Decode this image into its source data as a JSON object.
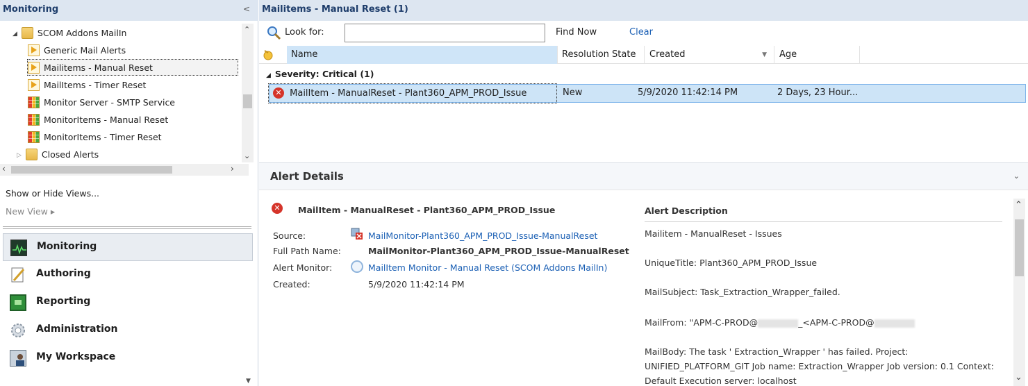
{
  "left": {
    "header_title": "Monitoring",
    "collapse_glyph": "<",
    "tree": [
      {
        "label": "SCOM Addons MailIn",
        "icon": "folder-icon",
        "expand": "▲"
      },
      {
        "label": "Generic Mail Alerts",
        "icon": "alert-view-icon"
      },
      {
        "label": "Mailitems - Manual Reset",
        "icon": "alert-view-icon",
        "selected": true
      },
      {
        "label": "MailItems - Timer Reset",
        "icon": "alert-view-icon"
      },
      {
        "label": "Monitor Server - SMTP Service",
        "icon": "state-view-icon"
      },
      {
        "label": "MonitorItems - Manual Reset",
        "icon": "state-view-icon"
      },
      {
        "label": "MonitorItems - Timer Reset",
        "icon": "state-view-icon"
      },
      {
        "label": "Closed Alerts",
        "icon": "folder-icon",
        "expand": "▷"
      }
    ],
    "show_hide": "Show or Hide Views...",
    "new_view": "New View ▸",
    "wunderbar": [
      {
        "label": "Monitoring",
        "icon": "monitoring-icon",
        "active": true
      },
      {
        "label": "Authoring",
        "icon": "authoring-icon"
      },
      {
        "label": "Reporting",
        "icon": "reporting-icon"
      },
      {
        "label": "Administration",
        "icon": "administration-icon"
      },
      {
        "label": "My Workspace",
        "icon": "workspace-icon"
      }
    ]
  },
  "right": {
    "header_title": "Mailitems - Manual Reset (1)",
    "search": {
      "label": "Look for:",
      "value": "",
      "find_now": "Find Now",
      "clear": "Clear"
    },
    "columns": [
      "Name",
      "Resolution State",
      "Created",
      "Age"
    ],
    "group_label": "Severity: Critical (1)",
    "row": {
      "name": "MailItem - ManualReset - Plant360_APM_PROD_Issue",
      "state": "New",
      "created": "5/9/2020 11:42:14 PM",
      "age": "2 Days, 23 Hour..."
    },
    "details": {
      "title": "Alert Details",
      "alert_name": "MailItem - ManualReset - Plant360_APM_PROD_Issue",
      "fields": [
        {
          "label": "Source:",
          "value": "MailMonitor-Plant360_APM_PROD_Issue-ManualReset"
        },
        {
          "label": "Full Path Name:",
          "value": "MailMonitor-Plant360_APM_PROD_Issue-ManualReset"
        },
        {
          "label": "Alert Monitor:",
          "value": "MailItem Monitor - Manual Reset (SCOM Addons MailIn)"
        },
        {
          "label": "Created:",
          "value": "5/9/2020 11:42:14 PM"
        }
      ],
      "desc_title": "Alert Description",
      "desc_lines": [
        "Mailitem - ManualReset - Issues",
        "UniqueTitle: Plant360_APM_PROD_Issue",
        "MailSubject: Task_Extraction_Wrapper_failed.",
        "MailFrom: \"APM-C-PROD@",
        "_<APM-C-PROD@",
        "MailBody: The task ' Extraction_Wrapper ' has failed. Project:",
        "UNIFIED_PLATFORM_GIT Job name: Extraction_Wrapper Job version: 0.1 Context:",
        "Default Execution server: localhost"
      ]
    },
    "colors": {
      "header_bg": "#dde6f1",
      "selection": "#cde4f7",
      "link": "#1a5fb4",
      "error": "#d5342a"
    }
  }
}
